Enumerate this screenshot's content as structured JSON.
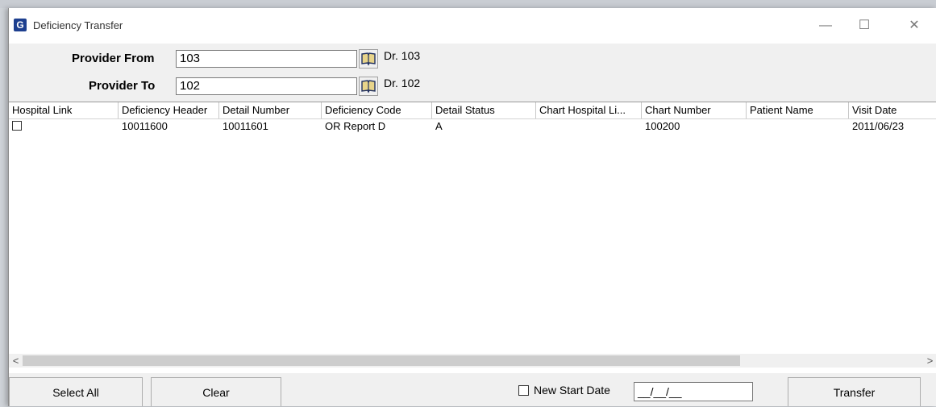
{
  "window": {
    "title": "Deficiency Transfer",
    "app_icon_glyph": "G"
  },
  "controls": {
    "minimize": "—",
    "maximize": "☐",
    "close": "✕"
  },
  "form": {
    "provider_from_label": "Provider From",
    "provider_from_value": "103",
    "provider_from_name": "Dr. 103",
    "provider_to_label": "Provider To",
    "provider_to_value": "102",
    "provider_to_name": "Dr. 102"
  },
  "grid": {
    "columns": [
      "Hospital Link",
      "Deficiency Header",
      "Detail Number",
      "Deficiency Code",
      "Detail Status",
      "Chart Hospital Li...",
      "Chart Number",
      "Patient Name",
      "Visit Date"
    ],
    "rows": [
      {
        "hospital_link_checked": false,
        "deficiency_header": "10011600",
        "detail_number": "10011601",
        "deficiency_code": "OR Report D",
        "detail_status": "A",
        "chart_hospital_link": "",
        "chart_number": "100200",
        "patient_name": "",
        "visit_date": "2011/06/23"
      }
    ]
  },
  "scroll": {
    "left": "<",
    "right": ">"
  },
  "footer": {
    "select_all": "Select All",
    "clear": "Clear",
    "new_start_date_label": "New Start Date",
    "new_start_date_value": "__/__/__",
    "transfer": "Transfer"
  },
  "colors": {
    "accent": "#1d3f8f",
    "window_bg": "#f0f0f0"
  },
  "icons": {
    "lookup": "book-icon",
    "app": "app-logo-icon"
  }
}
